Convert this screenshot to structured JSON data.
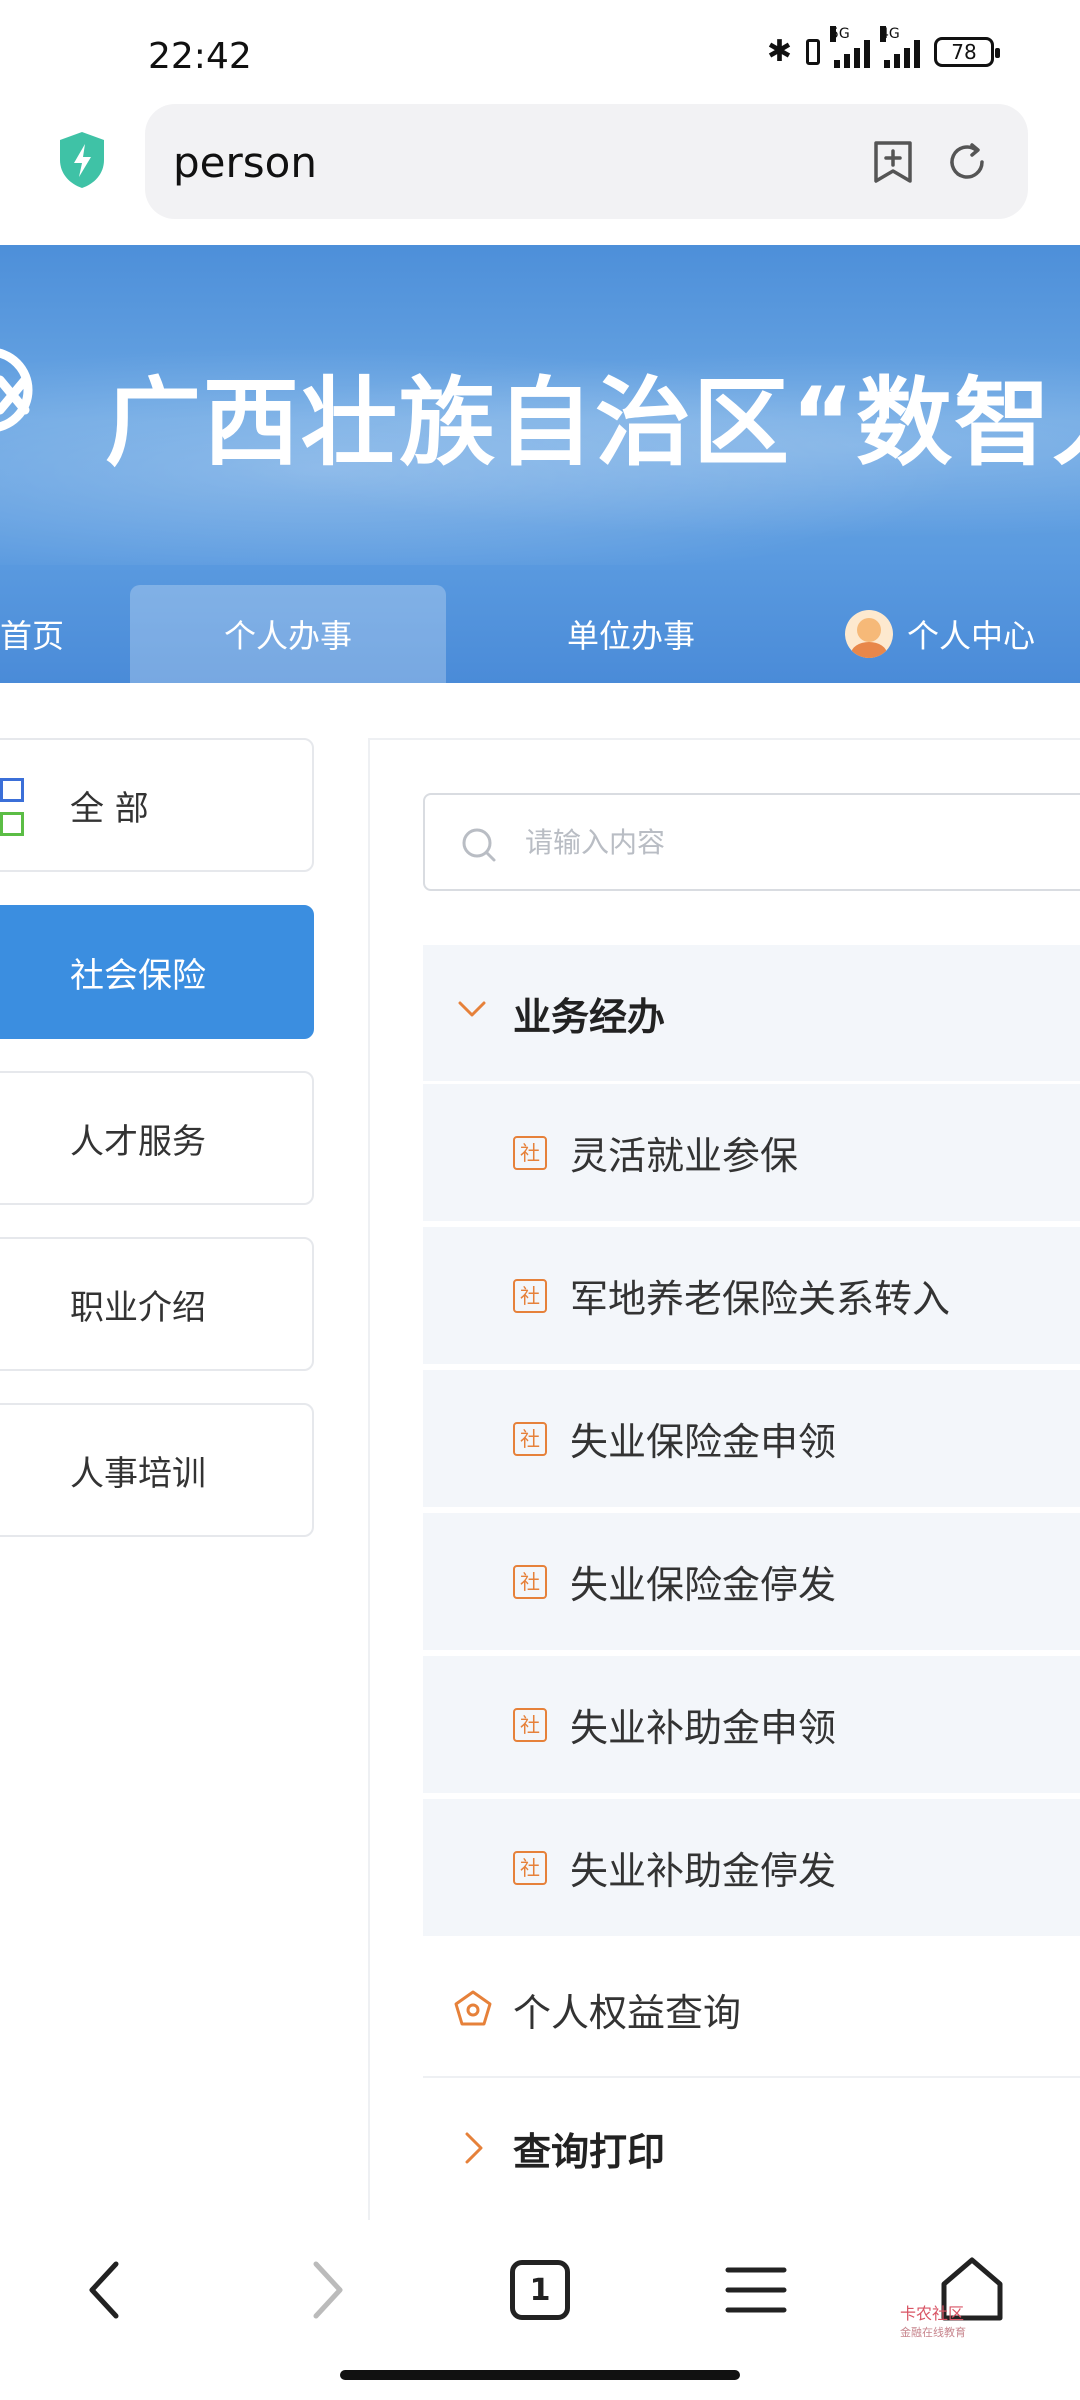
{
  "status": {
    "time": "22:42",
    "battery": "78",
    "net1": "5G",
    "net2": "4G"
  },
  "browser": {
    "url": "person",
    "tab_count": "1"
  },
  "banner": {
    "title": "广西壮族自治区“数智人"
  },
  "nav": {
    "items": [
      "首页",
      "个人办事",
      "单位办事",
      "个人中心"
    ],
    "active": "个人办事"
  },
  "sidebar": {
    "items": [
      "全 部",
      "社会保险",
      "人才服务",
      "职业介绍",
      "人事培训"
    ],
    "active": "社会保险"
  },
  "search": {
    "placeholder": "请输入内容"
  },
  "group": {
    "title": "业务经办",
    "badge": "社",
    "services": [
      "灵活就业参保",
      "军地养老保险关系转入",
      "失业保险金申领",
      "失业保险金停发",
      "失业补助金申领",
      "失业补助金停发"
    ]
  },
  "extra_rows": {
    "rights": "个人权益查询",
    "print": "查询打印"
  },
  "watermark": {
    "main": "卡农社区",
    "sub": "金融在线教育"
  },
  "colors": {
    "accent": "#3b8ee0",
    "badge": "#e6813a",
    "banner": "#4d8fd9"
  }
}
